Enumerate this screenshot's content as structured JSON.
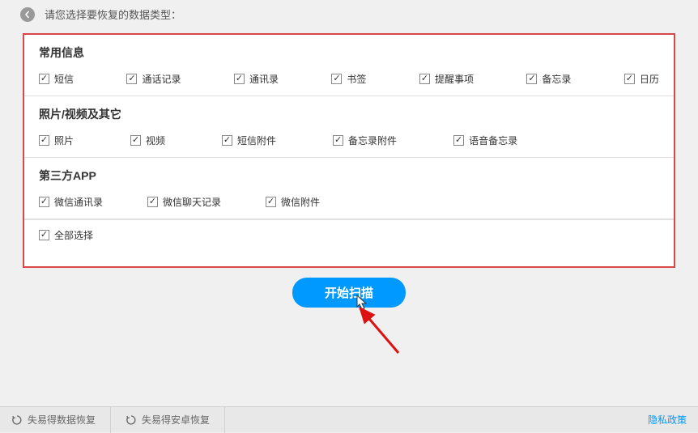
{
  "header": {
    "title": "请您选择要恢复的数据类型："
  },
  "sections": {
    "common": {
      "title": "常用信息",
      "items": [
        {
          "label": "短信",
          "checked": true
        },
        {
          "label": "通话记录",
          "checked": true
        },
        {
          "label": "通讯录",
          "checked": true
        },
        {
          "label": "书签",
          "checked": true
        },
        {
          "label": "提醒事项",
          "checked": true
        },
        {
          "label": "备忘录",
          "checked": true
        },
        {
          "label": "日历",
          "checked": true
        }
      ]
    },
    "media": {
      "title": "照片/视频及其它",
      "items": [
        {
          "label": "照片",
          "checked": true
        },
        {
          "label": "视频",
          "checked": true
        },
        {
          "label": "短信附件",
          "checked": true
        },
        {
          "label": "备忘录附件",
          "checked": true
        },
        {
          "label": "语音备忘录",
          "checked": true
        }
      ]
    },
    "thirdparty": {
      "title": "第三方APP",
      "items": [
        {
          "label": "微信通讯录",
          "checked": true
        },
        {
          "label": "微信聊天记录",
          "checked": true
        },
        {
          "label": "微信附件",
          "checked": true
        }
      ]
    }
  },
  "selectAll": {
    "label": "全部选择",
    "checked": true
  },
  "scanButton": {
    "label": "开始扫描"
  },
  "footer": {
    "left": [
      {
        "label": "失易得数据恢复"
      },
      {
        "label": "失易得安卓恢复"
      }
    ],
    "right": {
      "label": "隐私政策"
    }
  }
}
